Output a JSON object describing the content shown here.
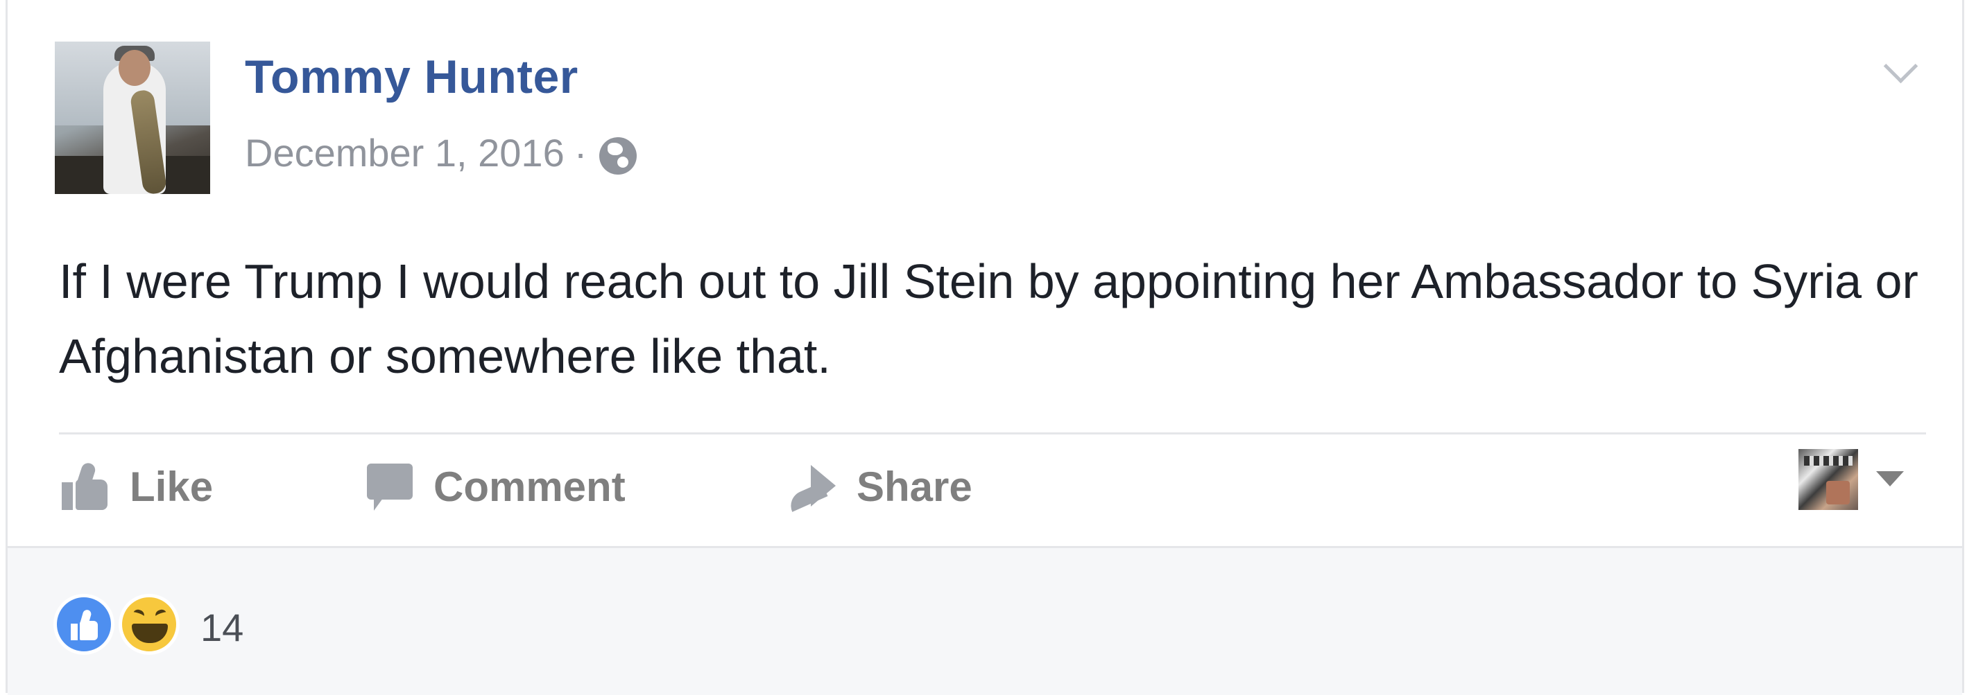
{
  "post": {
    "author_name": "Tommy Hunter",
    "date": "December 1, 2016",
    "separator": "·",
    "privacy_icon": "globe-icon",
    "menu_icon": "chevron-down-icon",
    "text": "If I were Trump I would reach out to Jill Stein by appointing her Ambassador to Syria or Afghanistan or somewhere like that."
  },
  "actions": {
    "like_label": "Like",
    "comment_label": "Comment",
    "share_label": "Share",
    "like_icon": "thumbs-up-icon",
    "comment_icon": "speech-bubble-icon",
    "share_icon": "share-arrow-icon",
    "post_as_menu_icon": "caret-down-icon"
  },
  "reactions": {
    "types": [
      "like",
      "haha"
    ],
    "count": "14"
  },
  "colors": {
    "author_link": "#365899",
    "meta_text": "#90949c",
    "body_text": "#1d2129",
    "action_text": "#7f7f7f",
    "footer_bg": "#f6f7f9",
    "like_blue": "#4e8ff0",
    "haha_yellow": "#f7c83d"
  }
}
